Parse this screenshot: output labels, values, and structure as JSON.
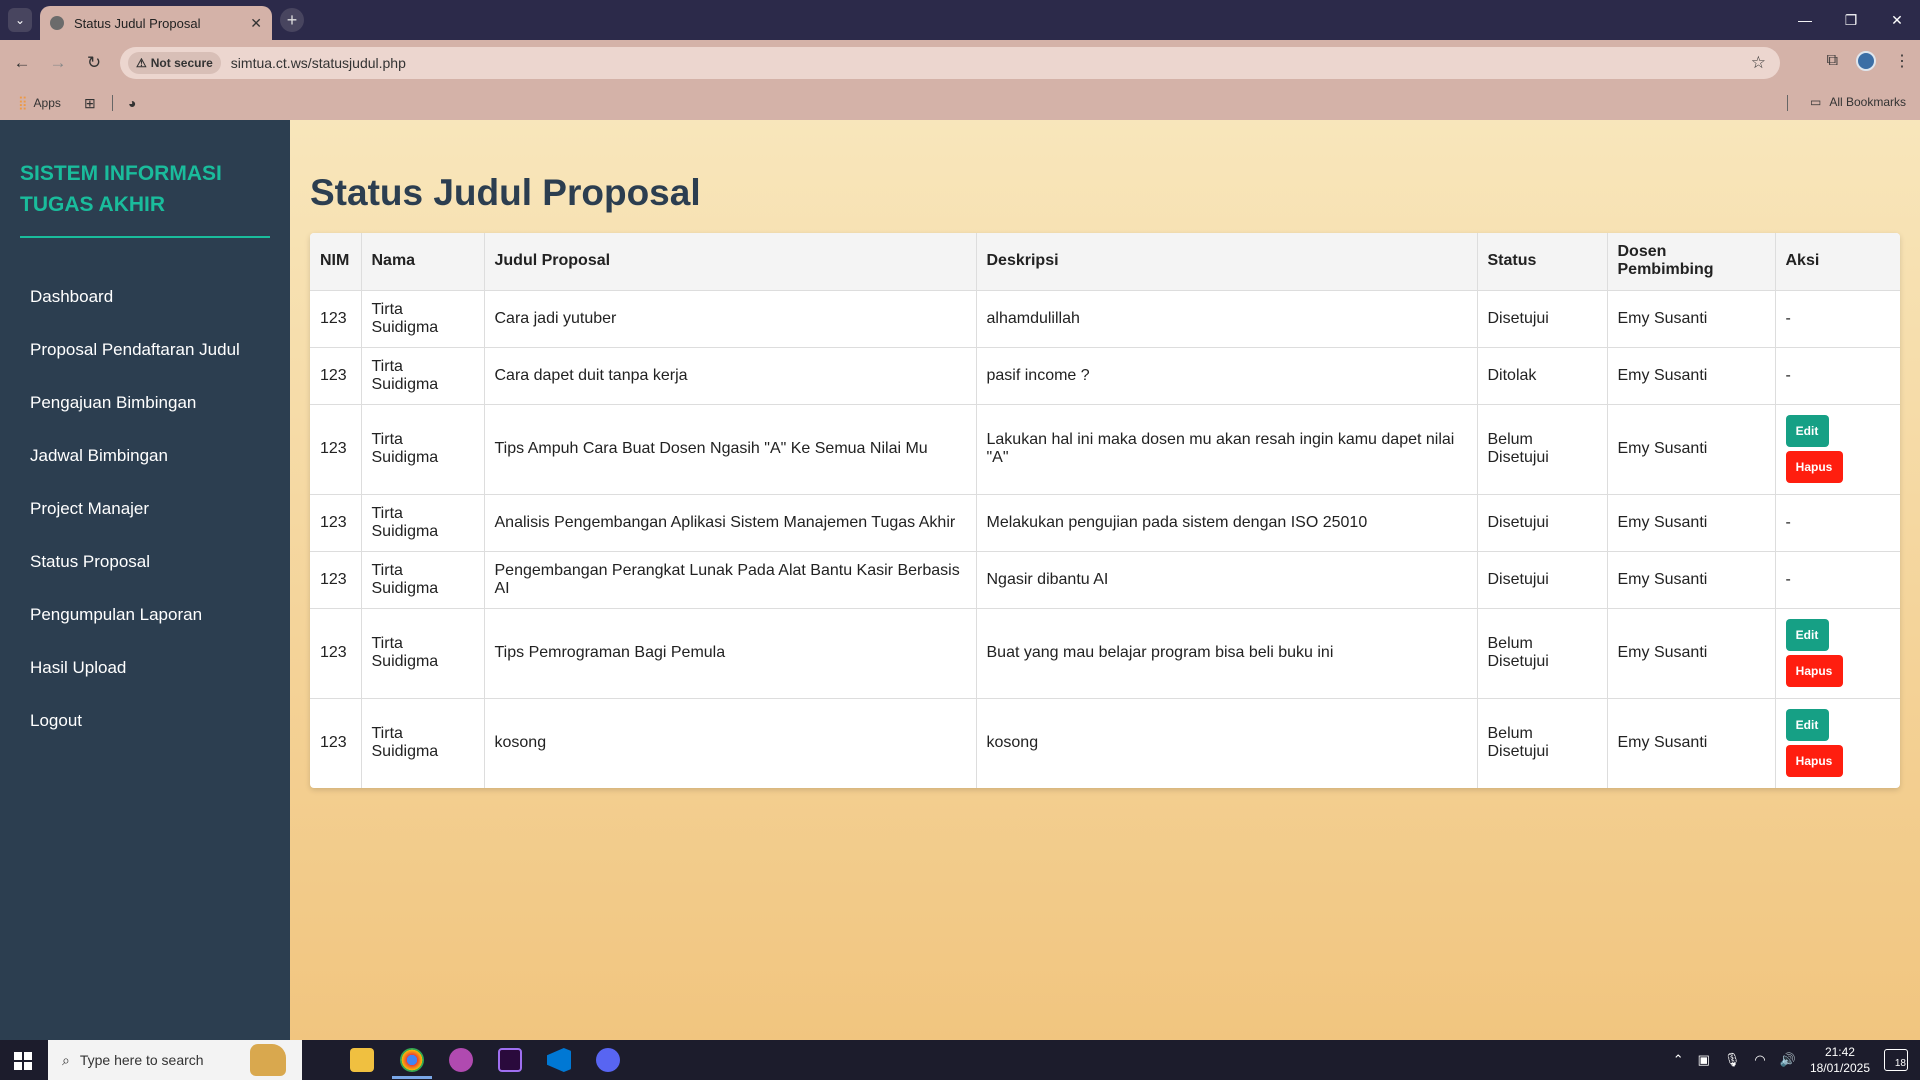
{
  "browser": {
    "tab_title": "Status Judul Proposal",
    "not_secure": "Not secure",
    "url": "simtua.ct.ws/statusjudul.php",
    "bookmarks": {
      "apps": "Apps",
      "all_bookmarks": "All Bookmarks"
    }
  },
  "sidebar": {
    "brand": "SISTEM INFORMASI TUGAS AKHIR",
    "items": [
      {
        "label": "Dashboard"
      },
      {
        "label": "Proposal Pendaftaran Judul"
      },
      {
        "label": "Pengajuan Bimbingan"
      },
      {
        "label": "Jadwal Bimbingan"
      },
      {
        "label": "Project Manajer"
      },
      {
        "label": "Status Proposal"
      },
      {
        "label": "Pengumpulan Laporan"
      },
      {
        "label": "Hasil Upload"
      },
      {
        "label": "Logout"
      }
    ]
  },
  "main": {
    "title": "Status Judul Proposal",
    "columns": [
      "NIM",
      "Nama",
      "Judul Proposal",
      "Deskripsi",
      "Status",
      "Dosen Pembimbing",
      "Aksi"
    ],
    "rows": [
      {
        "nim": "123",
        "nama": "Tirta Suidigma",
        "judul": "Cara jadi yutuber",
        "deskripsi": "alhamdulillah",
        "status": "Disetujui",
        "dosen": "Emy Susanti",
        "aksi": "-"
      },
      {
        "nim": "123",
        "nama": "Tirta Suidigma",
        "judul": "Cara dapet duit tanpa kerja",
        "deskripsi": "pasif income ?",
        "status": "Ditolak",
        "dosen": "Emy Susanti",
        "aksi": "-"
      },
      {
        "nim": "123",
        "nama": "Tirta Suidigma",
        "judul": "Tips Ampuh Cara Buat Dosen Ngasih \"A\" Ke Semua Nilai Mu",
        "deskripsi": "Lakukan hal ini maka dosen mu akan resah ingin kamu dapet nilai \"A\"",
        "status": "Belum Disetujui",
        "dosen": "Emy Susanti",
        "edit": "Edit",
        "hapus": "Hapus"
      },
      {
        "nim": "123",
        "nama": "Tirta Suidigma",
        "judul": "Analisis Pengembangan Aplikasi Sistem Manajemen Tugas Akhir",
        "deskripsi": "Melakukan pengujian pada sistem dengan ISO 25010",
        "status": "Disetujui",
        "dosen": "Emy Susanti",
        "aksi": "-"
      },
      {
        "nim": "123",
        "nama": "Tirta Suidigma",
        "judul": "Pengembangan Perangkat Lunak Pada Alat Bantu Kasir Berbasis AI",
        "deskripsi": "Ngasir dibantu AI",
        "status": "Disetujui",
        "dosen": "Emy Susanti",
        "aksi": "-"
      },
      {
        "nim": "123",
        "nama": "Tirta Suidigma",
        "judul": "Tips Pemrograman Bagi Pemula",
        "deskripsi": "Buat yang mau belajar program bisa beli buku ini",
        "status": "Belum Disetujui",
        "dosen": "Emy Susanti",
        "edit": "Edit",
        "hapus": "Hapus"
      },
      {
        "nim": "123",
        "nama": "Tirta Suidigma",
        "judul": "kosong",
        "deskripsi": "kosong",
        "status": "Belum Disetujui",
        "dosen": "Emy Susanti",
        "edit": "Edit",
        "hapus": "Hapus"
      }
    ]
  },
  "taskbar": {
    "search_placeholder": "Type here to search",
    "time": "21:42",
    "date": "18/01/2025",
    "notif_count": "18"
  },
  "colors": {
    "sidebar_bg": "#2c3e50",
    "brand_accent": "#1abc9c",
    "edit_button": "#16a085",
    "delete_button": "#ff1e0f"
  }
}
